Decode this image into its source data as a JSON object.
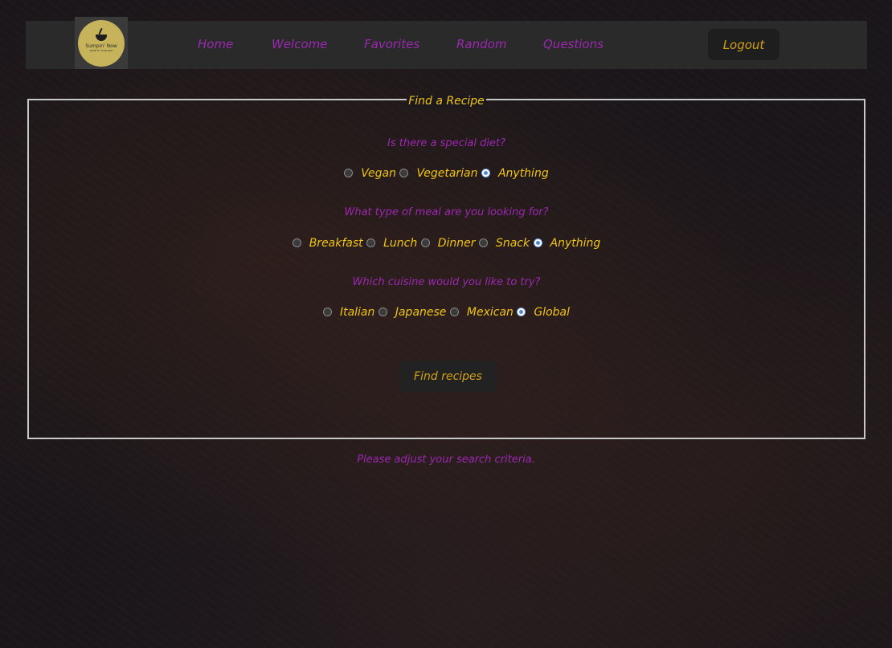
{
  "brand": {
    "logo_text": "Sumpin' Now",
    "logo_sub": "MAKE IT YOUR WAY"
  },
  "nav": {
    "links": [
      "Home",
      "Welcome",
      "Favorites",
      "Random",
      "Questions"
    ],
    "logout_label": "Logout"
  },
  "form": {
    "legend": "Find a Recipe",
    "diet": {
      "question": "Is there a special diet?",
      "options": [
        "Vegan",
        "Vegetarian",
        "Anything"
      ],
      "selected": "Anything"
    },
    "meal": {
      "question": "What type of meal are you looking for?",
      "options": [
        "Breakfast",
        "Lunch",
        "Dinner",
        "Snack",
        "Anything"
      ],
      "selected": "Anything"
    },
    "cuisine": {
      "question": "Which cuisine would you like to try?",
      "options": [
        "Italian",
        "Japanese",
        "Mexican",
        "Global"
      ],
      "selected": "Global"
    },
    "submit_label": "Find recipes"
  },
  "status_message": "Please adjust your search criteria.",
  "colors": {
    "accent_purple": "#9c27b0",
    "accent_gold": "#f0c419",
    "button_text": "#d4a017"
  }
}
